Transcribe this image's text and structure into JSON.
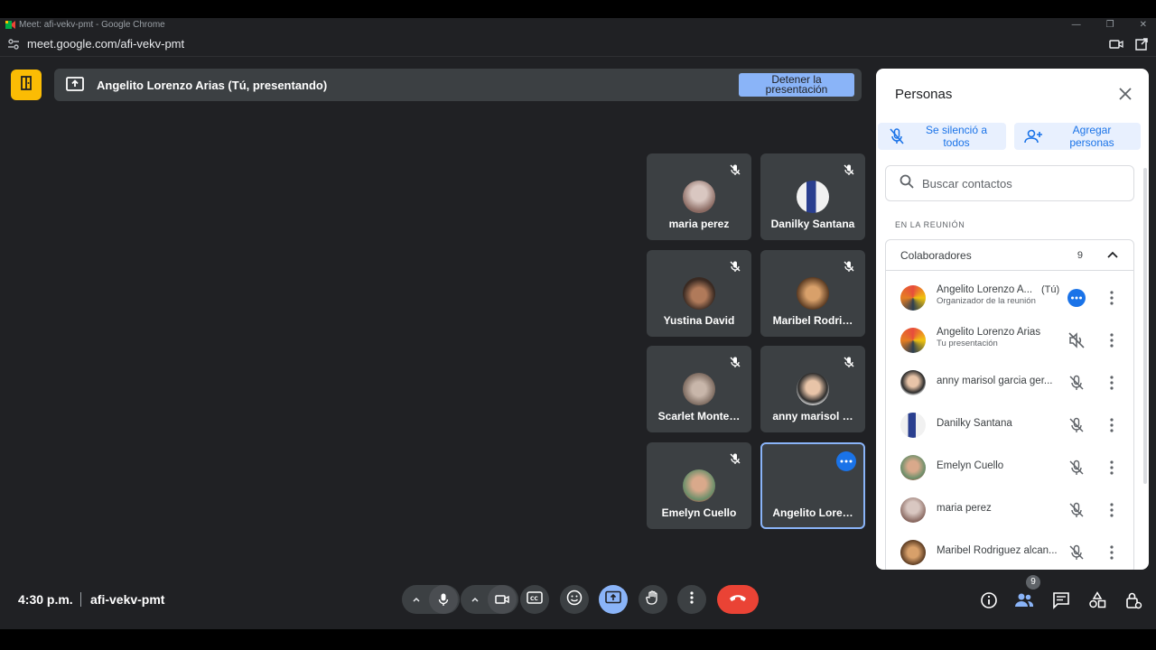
{
  "browser": {
    "window_title": "Meet: afi-vekv-pmt - Google Chrome",
    "url": "meet.google.com/afi-vekv-pmt"
  },
  "banner": {
    "text": "Angelito Lorenzo Arias (Tú, presentando)",
    "stop_label_1": "Detener la",
    "stop_label_2": "presentación"
  },
  "tiles": [
    {
      "name": "maria perez"
    },
    {
      "name": "Danilky Santana"
    },
    {
      "name": "Yustina David"
    },
    {
      "name": "Maribel Rodri…"
    },
    {
      "name": "Scarlet Monte…"
    },
    {
      "name": "anny marisol …"
    },
    {
      "name": "Emelyn Cuello"
    },
    {
      "name": "Angelito Lore…"
    }
  ],
  "panel": {
    "title": "Personas",
    "mute_all_1": "Se silenció a",
    "mute_all_2": "todos",
    "add_people_1": "Agregar",
    "add_people_2": "personas",
    "search_placeholder": "Buscar contactos",
    "section": "EN LA REUNIÓN",
    "group_name": "Colaboradores",
    "group_count": "9",
    "participants": [
      {
        "name": "Angelito Lorenzo A...",
        "tag": "(Tú)",
        "sub": "Organizador de la reunión"
      },
      {
        "name": "Angelito Lorenzo Arias",
        "sub": "Tu presentación"
      },
      {
        "name": "anny marisol garcia ger..."
      },
      {
        "name": "Danilky Santana"
      },
      {
        "name": "Emelyn Cuello"
      },
      {
        "name": "maria perez"
      },
      {
        "name": "Maribel Rodriguez alcan..."
      }
    ]
  },
  "footer": {
    "time": "4:30 p.m.",
    "meeting_code": "afi-vekv-pmt",
    "people_badge": "9"
  },
  "colors": {
    "background": "#202124",
    "tile": "#3c4043",
    "accent_blue": "#8ab4f8",
    "hangup_red": "#ea4335",
    "logo_yellow": "#fbbc04"
  }
}
